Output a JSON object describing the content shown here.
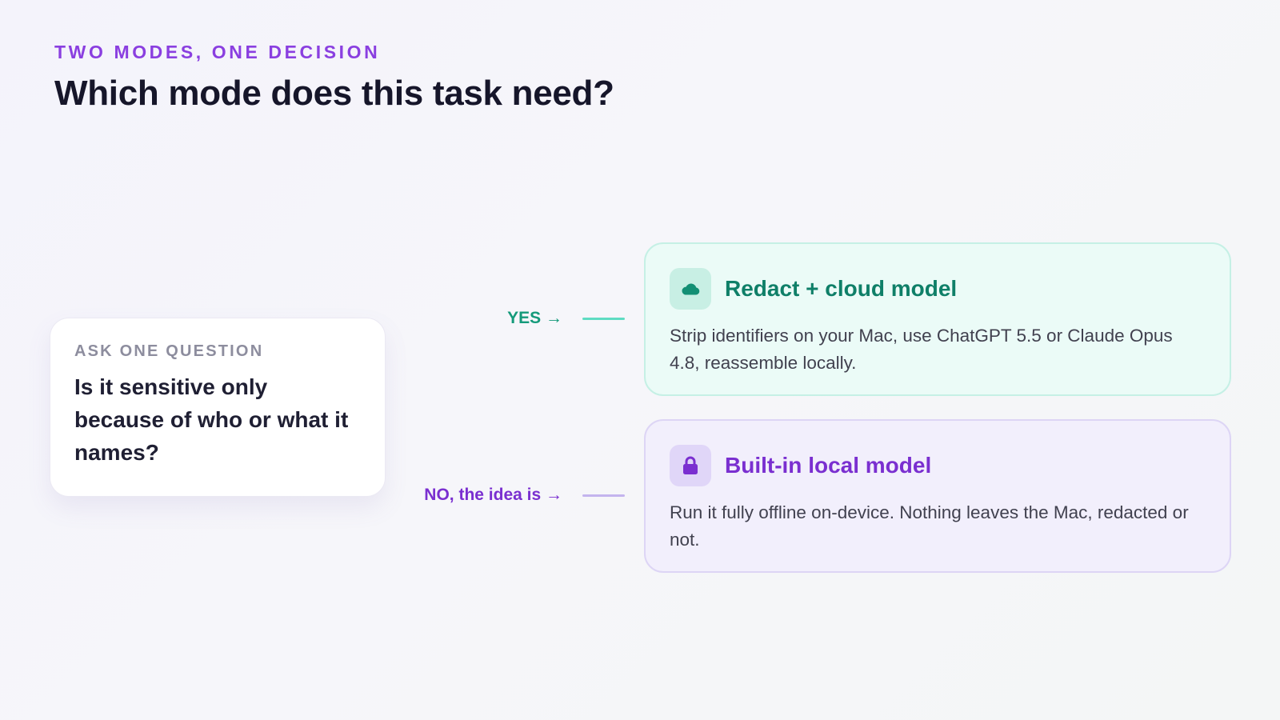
{
  "header": {
    "eyebrow": "TWO MODES, ONE DECISION",
    "title": "Which mode does this task need?"
  },
  "question": {
    "eyebrow": "ASK ONE QUESTION",
    "text": "Is it sensitive only because of who or what it names?"
  },
  "branches": {
    "yes": {
      "label": "YES →",
      "result": {
        "icon": "cloud-icon",
        "title": "Redact + cloud model",
        "description": "Strip identifiers on your Mac, use ChatGPT 5.5 or Claude Opus 4.8, reassemble locally."
      }
    },
    "no": {
      "label": "NO, the idea is →",
      "result": {
        "icon": "lock-icon",
        "title": "Built-in local model",
        "description": "Run it fully offline on-device. Nothing leaves the Mac, redacted or not."
      }
    }
  },
  "colors": {
    "eyebrow": "#8a3fe0",
    "yes_accent": "#149a7a",
    "yes_connector": "#5fdcc2",
    "no_accent": "#7a2fd0",
    "no_connector": "#c4b4ee",
    "cloud_card_bg": "#ebfbf7",
    "local_card_bg": "#f2effc"
  }
}
